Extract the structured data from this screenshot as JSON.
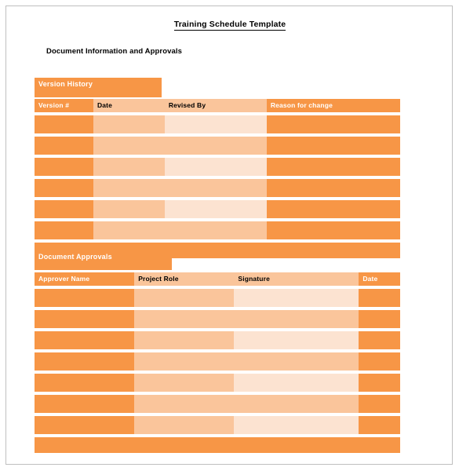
{
  "document": {
    "title": "Training  Schedule Template",
    "subtitle": "Document Information and Approvals"
  },
  "colors": {
    "accent_orange": "#F79646",
    "medium_peach": "#FAC59B",
    "light_peach": "#FCE3D1",
    "header_text_on_orange": "#FFFFFF",
    "header_text_on_peach": "#000000",
    "page_border": "#BFBFBF",
    "page_background": "#FFFFFF"
  },
  "sections": [
    {
      "banner_label": "Version History",
      "table": {
        "name": "version-history-table",
        "columns": [
          {
            "header": "Version #",
            "fill": "orange",
            "width_pct": 16.1
          },
          {
            "header": "Date",
            "fill": "med",
            "width_pct": 19.5
          },
          {
            "header": "Revised By",
            "fill": "alt",
            "width_pct": 27.9
          },
          {
            "header": "Reason for change",
            "fill": "orange",
            "width_pct": 36.5
          }
        ],
        "body_row_count": 6,
        "footer_row": true,
        "rows": [
          [
            "",
            "",
            "",
            ""
          ],
          [
            "",
            "",
            "",
            ""
          ],
          [
            "",
            "",
            "",
            ""
          ],
          [
            "",
            "",
            "",
            ""
          ],
          [
            "",
            "",
            "",
            ""
          ],
          [
            "",
            "",
            "",
            ""
          ]
        ]
      }
    },
    {
      "banner_label": "Document Approvals",
      "table": {
        "name": "document-approvals-table",
        "columns": [
          {
            "header": "Approver Name",
            "fill": "orange",
            "width_pct": 27.3
          },
          {
            "header": "Project Role",
            "fill": "med",
            "width_pct": 27.3
          },
          {
            "header": "Signature",
            "fill": "alt",
            "width_pct": 34.1
          },
          {
            "header": "Date",
            "fill": "orange",
            "width_pct": 11.3
          }
        ],
        "body_row_count": 7,
        "footer_row": true,
        "rows": [
          [
            "",
            "",
            "",
            ""
          ],
          [
            "",
            "",
            "",
            ""
          ],
          [
            "",
            "",
            "",
            ""
          ],
          [
            "",
            "",
            "",
            ""
          ],
          [
            "",
            "",
            "",
            ""
          ],
          [
            "",
            "",
            "",
            ""
          ],
          [
            "",
            "",
            "",
            ""
          ]
        ]
      }
    }
  ]
}
